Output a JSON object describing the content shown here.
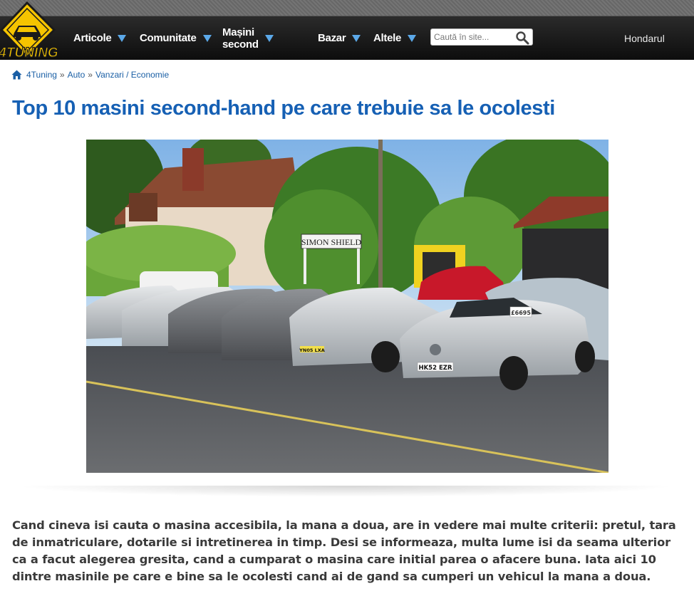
{
  "logo": {
    "text": "4TUNING"
  },
  "nav": {
    "items": [
      {
        "label": "Articole"
      },
      {
        "label": "Comunitate"
      },
      {
        "label": "Mașini second"
      },
      {
        "label": "Bazar"
      },
      {
        "label": "Altele"
      }
    ],
    "search": {
      "placeholder": "Caută în site..."
    },
    "user": "Hondarul"
  },
  "breadcrumb": {
    "items": [
      "4Tuning",
      "Auto",
      "Vanzari / Economie"
    ],
    "separator": "»"
  },
  "article": {
    "title": "Top 10 masini second-hand pe care trebuie sa le ocolesti",
    "image": {
      "sign_text": "SIMON SHIELD",
      "plates": [
        "HK52 EZR",
        "YN05 LXA"
      ],
      "price_tag": "£6695"
    },
    "intro": "Cand cineva isi cauta o masina accesibila, la mana a doua, are in vedere mai multe criterii: pretul, tara de inmatriculare, dotarile si intretinerea in timp. Desi se informeaza, multa lume isi da seama ulterior ca a facut alegerea gresita, cand a cumparat o masina care initial parea o afacere buna. Iata aici 10 dintre masinile pe care e bine sa le ocolesti cand ai de gand sa cumperi un vehicul la mana a doua."
  },
  "colors": {
    "nav_bg": "#151515",
    "nav_arrow": "#5ba8e8",
    "title": "#1660b4",
    "link": "#1a5fa5",
    "logo_yellow": "#f5c400"
  }
}
